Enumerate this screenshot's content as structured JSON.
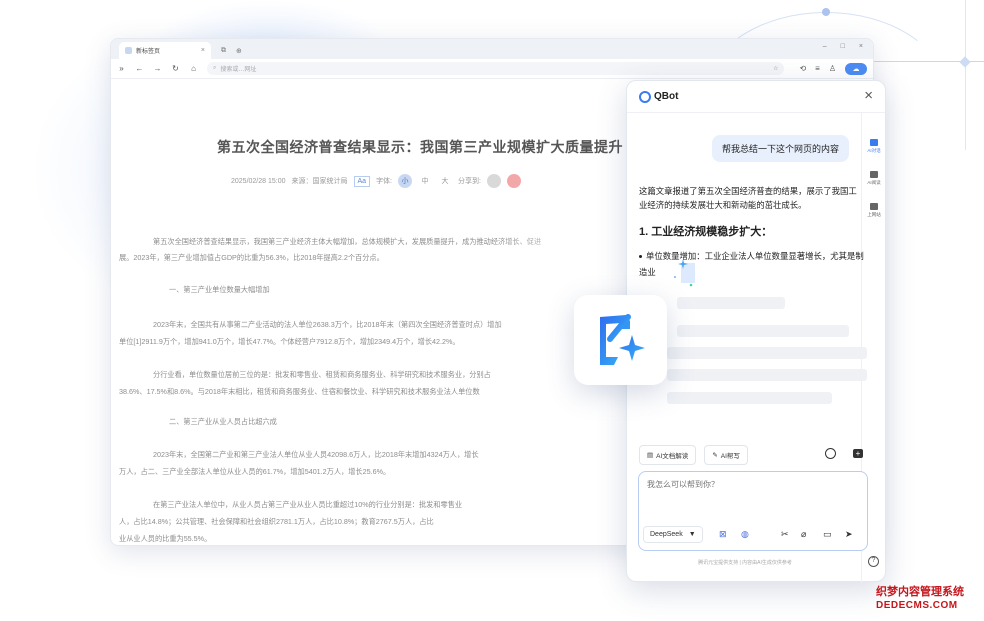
{
  "browser": {
    "tab_title": "新标签页",
    "tab_close": "×",
    "address_placeholder": "搜索或…网址",
    "window_controls": [
      "–",
      "□",
      "×"
    ]
  },
  "article": {
    "title": "第五次全国经济普查结果显示：我国第三产业规模扩大质量提升",
    "date": "2025/02/28 15:00",
    "source": "来源：国家统计局",
    "font_size_label": "字体:",
    "size_small": "小",
    "size_medium": "中",
    "size_large": "大",
    "share_label": "分享到:",
    "aa": "Aa",
    "paragraphs": [
      "第五次全国经济普查结果显示，我国第三产业经济主体大幅增加，总体规模扩大，发展质量提升，成为推动经济增长、促进",
      "展。2023年，第三产业增加值占GDP的比重为56.3%，比2018年提高2.2个百分点。",
      "一、第三产业单位数量大幅增加",
      "2023年末，全国共有从事第二产业活动的法人单位2638.3万个，比2018年末（第四次全国经济普查时点）增加",
      "单位[1]2911.9万个，增加941.0万个，增长47.7%。个体经营户7912.8万个，增加2349.4万个，增长42.2%。",
      "分行业看，单位数量位居前三位的是：批发和零售业、租赁和商务服务业、科学研究和技术服务业，分别占",
      "38.6%、17.5%和8.6%。与2018年末相比，租赁和商务服务业、住宿和餐饮业、科学研究和技术服务业法人单位数",
      "二、第三产业从业人员占比超六成",
      "2023年末，全国第二产业和第三产业法人单位从业人员42098.6万人，比2018年末增加4324万人，增长",
      "万人，占二、三产业全部法人单位从业人员的61.7%，增加5401.2万人，增长25.6%。",
      "在第三产业法人单位中，从业人员占第三产业从业人员比重超过10%的行业分别是：批发和零售业",
      "人，占比14.8%；公共管理、社会保障和社会组织2781.1万人，占比10.8%；教育2767.5万人，占比",
      "业从业人员的比重为55.5%。"
    ]
  },
  "qbot": {
    "name": "QBot",
    "close": "×",
    "rail": [
      {
        "label": "AI对话"
      },
      {
        "label": "AI阅读"
      },
      {
        "label": "上网站"
      }
    ],
    "help": "?",
    "user_message": "帮我总结一下这个网页的内容",
    "bot_intro": "这篇文章报道了第五次全国经济普查的结果，展示了我国工业经济的持续发展壮大和新动能的茁壮成长。",
    "bot_heading": "1. 工业经济规模稳步扩大：",
    "bot_bullet": "单位数量增加：工业企业法人单位数量显著增长，尤其是制造业",
    "actions": {
      "doc_read": "AI文档解读",
      "write": "AI帮写"
    },
    "input_placeholder": "我怎么可以帮到你？",
    "model": "DeepSeek",
    "disclaimer": "腾讯元宝提供支持 | 内容由AI生成仅供参考"
  },
  "watermark": {
    "line1": "织梦内容管理系统",
    "line2": "DEDECMS.COM"
  },
  "colors": {
    "accent": "#3b7bf0",
    "user_bubble": "#e8f0fd",
    "watermark": "#c4161c"
  }
}
